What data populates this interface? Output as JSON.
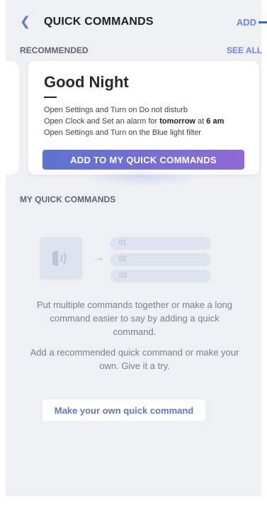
{
  "header": {
    "back_icon": "chevron-left-icon",
    "title": "QUICK COMMANDS",
    "add_label": "ADD"
  },
  "recommended": {
    "label": "RECOMMENDED",
    "see_all_label": "SEE ALL",
    "card": {
      "title": "Good Night",
      "lines": [
        {
          "text": "Open Settings and Turn on Do not disturb"
        },
        {
          "pre": "Open Clock and Set an alarm for ",
          "bold1": "tomorrow",
          "mid": " at ",
          "bold2": "6 am"
        },
        {
          "text": "Open Settings and Turn on the Blue light filter"
        }
      ],
      "button_label": "ADD TO MY QUICK COMMANDS"
    }
  },
  "my_quick_commands": {
    "label": "MY QUICK COMMANDS",
    "illustration": {
      "icon": "voice-command-icon",
      "arrow_icon": "arrow-right-icon",
      "slots": [
        "01",
        "02",
        "03"
      ]
    },
    "description_1": "Put multiple commands together or make a long command easier to say by adding a quick command.",
    "description_2": "Add a recommended quick command or make your own. Give it a try.",
    "make_button_label": "Make your own quick command"
  },
  "colors": {
    "accent": "#6d87e0",
    "button_gradient_start": "#5c73d2",
    "button_gradient_end": "#8f6ad6",
    "background": "#eef0f4"
  }
}
